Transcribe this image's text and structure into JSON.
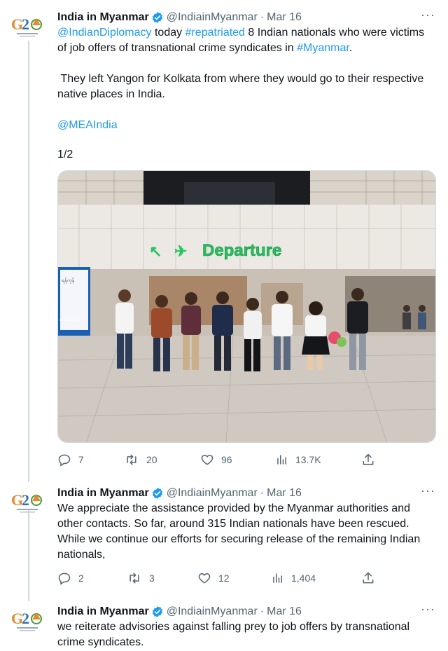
{
  "tweets": [
    {
      "avatar_text": "G20",
      "name": "India in Myanmar",
      "handle": "@IndiainMyanmar",
      "separator": "·",
      "date": "Mar 16",
      "more": "···",
      "body": {
        "mention1": "@IndianDiplomacy",
        "text1": " today ",
        "hashtag1": "#repatriated",
        "text2": " 8 Indian nationals who were victims of job offers of transnational crime syndicates in ",
        "hashtag2": "#Myanmar",
        "text3": ".",
        "para2": " They left Yangon for Kolkata from where they would go to their respective native places in India.",
        "mention2": "@MEAIndia",
        "counter": "1/2"
      },
      "media": {
        "sign_text": "Departure",
        "sign_color": "#22c55e",
        "left_screen_text": "ရန်ကုန်",
        "left_screen_number": "08 - 00 000 58 771"
      },
      "stats": {
        "replies": "7",
        "retweets": "20",
        "likes": "96",
        "views": "13.7K"
      }
    },
    {
      "avatar_text": "G20",
      "name": "India in Myanmar",
      "handle": "@IndiainMyanmar",
      "separator": "·",
      "date": "Mar 16",
      "more": "···",
      "body_text": "We appreciate the assistance provided by the Myanmar authorities and other contacts. So far, around 315 Indian nationals have been rescued. While we continue our efforts for securing release of the remaining Indian nationals,",
      "stats": {
        "replies": "2",
        "retweets": "3",
        "likes": "12",
        "views": "1,404"
      }
    },
    {
      "avatar_text": "G20",
      "name": "India in Myanmar",
      "handle": "@IndiainMyanmar",
      "separator": "·",
      "date": "Mar 16",
      "more": "···",
      "body_text": "we reiterate advisories against falling prey to job offers by transnational crime syndicates."
    }
  ],
  "colors": {
    "link": "#1d9bf0",
    "verified": "#1d9bf0",
    "muted": "#536471",
    "thread_line": "#cfd9de"
  },
  "icons": [
    "g20-logo-icon",
    "verified-badge-icon",
    "more-icon",
    "reply-icon",
    "retweet-icon",
    "like-icon",
    "views-icon",
    "share-icon"
  ]
}
